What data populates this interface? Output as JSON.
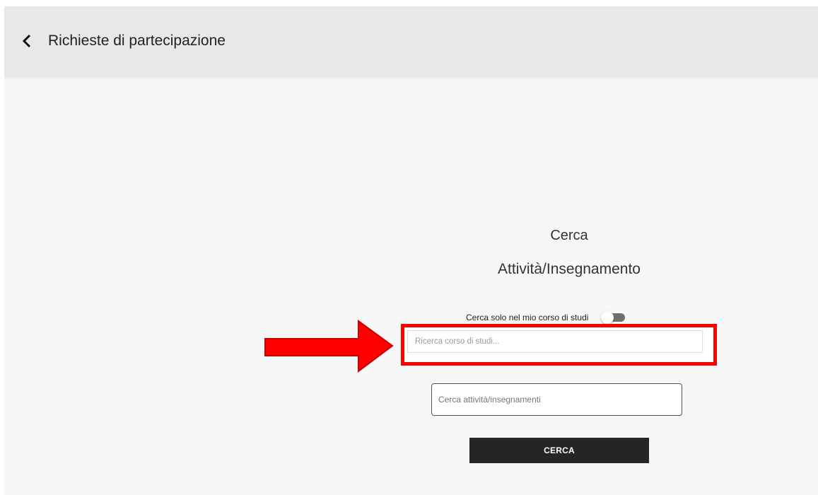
{
  "header": {
    "title": "Richieste di partecipazione",
    "back_icon": "chevron-left-icon"
  },
  "search": {
    "title_line1": "Cerca",
    "title_line2": "Attività/Insegnamento",
    "toggle_label": "Cerca solo nel mio corso di studi",
    "toggle_on": false,
    "course_placeholder": "Ricerca corso di studi...",
    "activity_placeholder": "Cerca attività/insegnamenti",
    "button_label": "CERCA"
  },
  "annotation": {
    "arrow_icon": "red-arrow-right-icon",
    "color": "#ff0000"
  },
  "colors": {
    "header_bg": "#e8e8e8",
    "page_bg": "#f7f7f7",
    "button_bg": "#252525",
    "toggle_track": "#6f6f6f",
    "highlight": "#ff0000"
  }
}
